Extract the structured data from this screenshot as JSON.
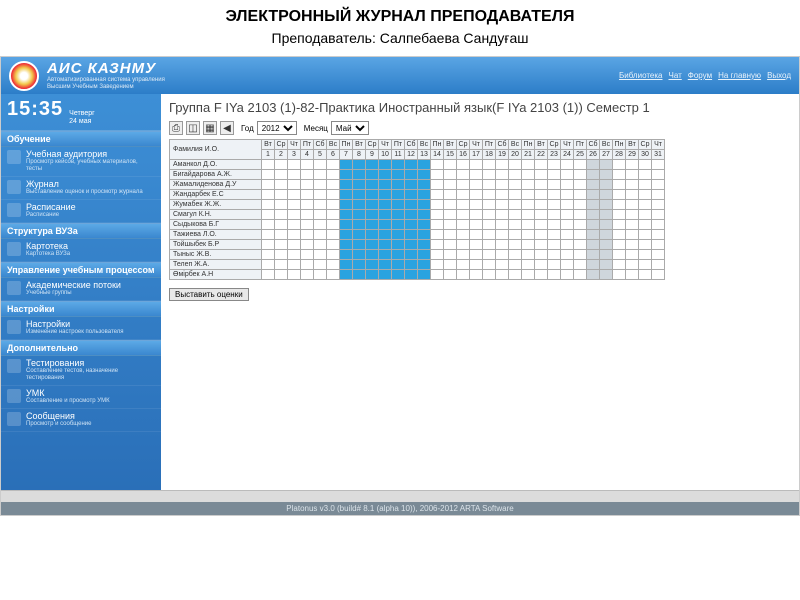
{
  "slide": {
    "title": "ЭЛЕКТРОННЫЙ ЖУРНАЛ ПРЕПОДАВАТЕЛЯ",
    "subtitle": "Преподаватель: Салпебаева Сандуғаш"
  },
  "header": {
    "brand": "АИС КАЗНМУ",
    "brand_sub1": "Автоматизированная система управления",
    "brand_sub2": "Высшим Учебным Заведением",
    "links": [
      "Библиотека",
      "Чат",
      "Форум",
      "На главную",
      "Выход"
    ]
  },
  "clock": {
    "time": "15:35",
    "dow": "Четверг",
    "date": "24 мая"
  },
  "sidebar": [
    {
      "type": "cat",
      "label": "Обучение"
    },
    {
      "type": "item",
      "label": "Учебная аудитория",
      "sub": "Просмотр кейсов, учебных материалов, тесты"
    },
    {
      "type": "item",
      "label": "Журнал",
      "sub": "Выставление оценок и просмотр журнала"
    },
    {
      "type": "item",
      "label": "Расписание",
      "sub": "Расписание"
    },
    {
      "type": "cat",
      "label": "Структура ВУЗа"
    },
    {
      "type": "item",
      "label": "Картотека",
      "sub": "Картотека ВУЗа"
    },
    {
      "type": "cat",
      "label": "Управление учебным процессом"
    },
    {
      "type": "item",
      "label": "Академические потоки",
      "sub": "Учебные группы"
    },
    {
      "type": "cat",
      "label": "Настройки"
    },
    {
      "type": "item",
      "label": "Настройки",
      "sub": "Изменение настроек пользователя"
    },
    {
      "type": "cat",
      "label": "Дополнительно"
    },
    {
      "type": "item",
      "label": "Тестирования",
      "sub": "Составление тестов, назначение тестирования"
    },
    {
      "type": "item",
      "label": "УМК",
      "sub": "Составление и просмотр УМК"
    },
    {
      "type": "item",
      "label": "Сообщения",
      "sub": "Просмотр и сообщение"
    }
  ],
  "main": {
    "title": "Группа F IYa 2103 (1)-82-Практика Иностранный язык(F IYa 2103 (1)) Семестр 1",
    "toolbar": {
      "year_label": "Год",
      "year_value": "2012",
      "month_label": "Месяц",
      "month_value": "Май"
    },
    "name_header": "Фамилия И.О.",
    "days_short": [
      "Вт",
      "Ср",
      "Чт",
      "Пт",
      "Сб",
      "Вс",
      "Пн",
      "Вт",
      "Ср",
      "Чт",
      "Пт",
      "Сб",
      "Вс",
      "Пн",
      "Вт",
      "Ср",
      "Чт",
      "Пт",
      "Сб",
      "Вс",
      "Пн",
      "Вт",
      "Ср",
      "Чт",
      "Пт",
      "Сб",
      "Вс",
      "Пн",
      "Вт",
      "Ср",
      "Чт"
    ],
    "day_nums": [
      1,
      2,
      3,
      4,
      5,
      6,
      7,
      8,
      9,
      10,
      11,
      12,
      13,
      14,
      15,
      16,
      17,
      18,
      19,
      20,
      21,
      22,
      23,
      24,
      25,
      26,
      27,
      28,
      29,
      30,
      31
    ],
    "blue_days": [
      7,
      8,
      9,
      10,
      11,
      12,
      13
    ],
    "grey_days": [
      26,
      27
    ],
    "weekend_idx": [
      6,
      13,
      20,
      27
    ],
    "students": [
      "Аманкол Д.О.",
      "Бигайдарова А.Ж.",
      "Жамалиденова Д.У",
      "Жандарбек Е.С",
      "Жумабек Ж.Ж.",
      "Смагул К.Н.",
      "Сыдыкова Б.Г",
      "Тажиева Л.О.",
      "Тойшыбек Б.Р",
      "Тыныс Ж.В.",
      "Телеп Ж.А.",
      "Өмірбек А.Н"
    ],
    "submit_label": "Выставить оценки"
  },
  "footer": "Platonus v3.0 (build# 8.1 (alpha 10)), 2006-2012 ARTA Software"
}
